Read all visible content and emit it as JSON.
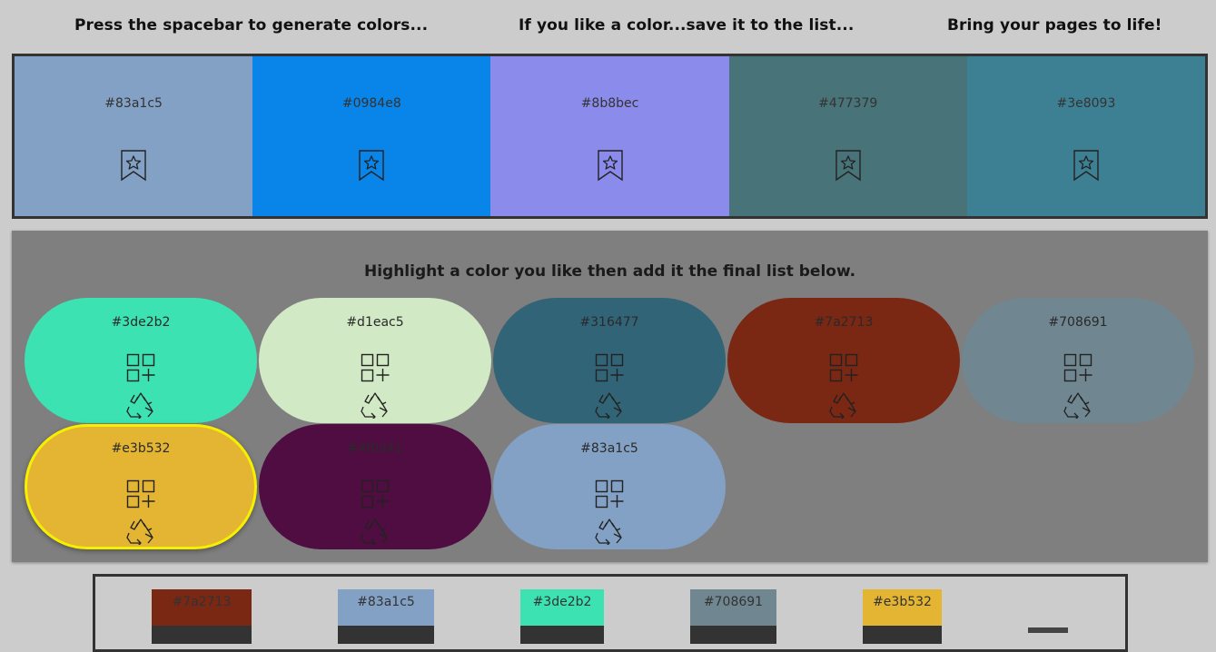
{
  "header": {
    "instruction_1": "Press the spacebar to generate colors...",
    "instruction_2": "If you like a color...save it to the list...",
    "instruction_3": "Bring your pages to life!"
  },
  "generated_colors": [
    {
      "hex": "#83a1c5",
      "color": "#83a1c5",
      "icon": "bookmark-star-icon"
    },
    {
      "hex": "#0984e8",
      "color": "#0984e8",
      "icon": "bookmark-star-icon"
    },
    {
      "hex": "#8b8bec",
      "color": "#8b8bec",
      "icon": "bookmark-star-icon"
    },
    {
      "hex": "#477379",
      "color": "#477379",
      "icon": "bookmark-star-icon"
    },
    {
      "hex": "#3e8093",
      "color": "#3e8093",
      "icon": "bookmark-star-icon"
    }
  ],
  "palette": {
    "title": "Highlight a color you like then add it the final list below.",
    "selected_color": "#e3b532",
    "highlight_color": "#f6f000",
    "items": [
      {
        "hex": "#3de2b2",
        "color": "#3de2b2"
      },
      {
        "hex": "#d1eac5",
        "color": "#d1eac5"
      },
      {
        "hex": "#316477",
        "color": "#316477"
      },
      {
        "hex": "#7a2713",
        "color": "#7a2713"
      },
      {
        "hex": "#708691",
        "color": "#708691"
      },
      {
        "hex": "#e3b532",
        "color": "#e3b532"
      },
      {
        "hex": "#4f0d41",
        "color": "#4f0d41"
      },
      {
        "hex": "#83a1c5",
        "color": "#83a1c5"
      }
    ],
    "icons": [
      "add-to-list-icon",
      "recycle-icon"
    ]
  },
  "final_list": [
    {
      "hex": "#7a2713",
      "color": "#7a2713"
    },
    {
      "hex": "#83a1c5",
      "color": "#83a1c5"
    },
    {
      "hex": "#3de2b2",
      "color": "#3de2b2"
    },
    {
      "hex": "#708691",
      "color": "#708691"
    },
    {
      "hex": "#e3b532",
      "color": "#e3b532"
    }
  ],
  "colors": {
    "page_background": "#cccccc",
    "palette_panel": "#7f7f7f",
    "border": "#333333"
  }
}
